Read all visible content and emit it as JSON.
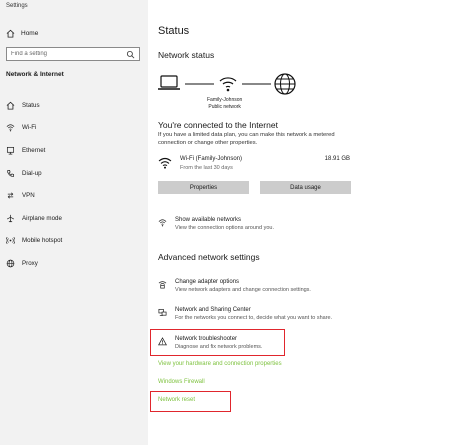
{
  "window": {
    "title": "Settings"
  },
  "sidebar": {
    "home_label": "Home",
    "search_placeholder": "Find a setting",
    "section_title": "Network & Internet",
    "items": [
      {
        "label": "Status",
        "icon": "home-icon"
      },
      {
        "label": "Wi-Fi",
        "icon": "wifi-icon"
      },
      {
        "label": "Ethernet",
        "icon": "ethernet-icon"
      },
      {
        "label": "Dial-up",
        "icon": "phone-icon"
      },
      {
        "label": "VPN",
        "icon": "vpn-icon"
      },
      {
        "label": "Airplane mode",
        "icon": "airplane-icon"
      },
      {
        "label": "Mobile hotspot",
        "icon": "hotspot-icon"
      },
      {
        "label": "Proxy",
        "icon": "globe-icon"
      }
    ]
  },
  "main": {
    "title": "Status",
    "network_status_heading": "Network status",
    "network_name": "Family-Johnson",
    "network_type": "Public network",
    "connected_heading": "You're connected to the Internet",
    "connected_desc": "If you have a limited data plan, you can make this network a metered connection or change other properties.",
    "wifi": {
      "name": "Wi-Fi (Family-Johnson)",
      "sub": "From the last 30 days",
      "size": "18.91 GB"
    },
    "buttons": {
      "properties": "Properties",
      "data_usage": "Data usage"
    },
    "show_networks": {
      "title": "Show available networks",
      "desc": "View the connection options around you."
    },
    "advanced_heading": "Advanced network settings",
    "adapter": {
      "title": "Change adapter options",
      "desc": "View network adapters and change connection settings."
    },
    "sharing": {
      "title": "Network and Sharing Center",
      "desc": "For the networks you connect to, decide what you want to share."
    },
    "troubleshooter": {
      "title": "Network troubleshooter",
      "desc": "Diagnose and fix network problems."
    },
    "links": {
      "hardware": "View your hardware and connection properties",
      "firewall": "Windows Firewall",
      "reset": "Network reset"
    }
  },
  "colors": {
    "sidebar_bg": "#f2f2f2",
    "button_bg": "#cccccc",
    "link_green": "#7ec23f",
    "highlight_red": "#e0262d"
  }
}
